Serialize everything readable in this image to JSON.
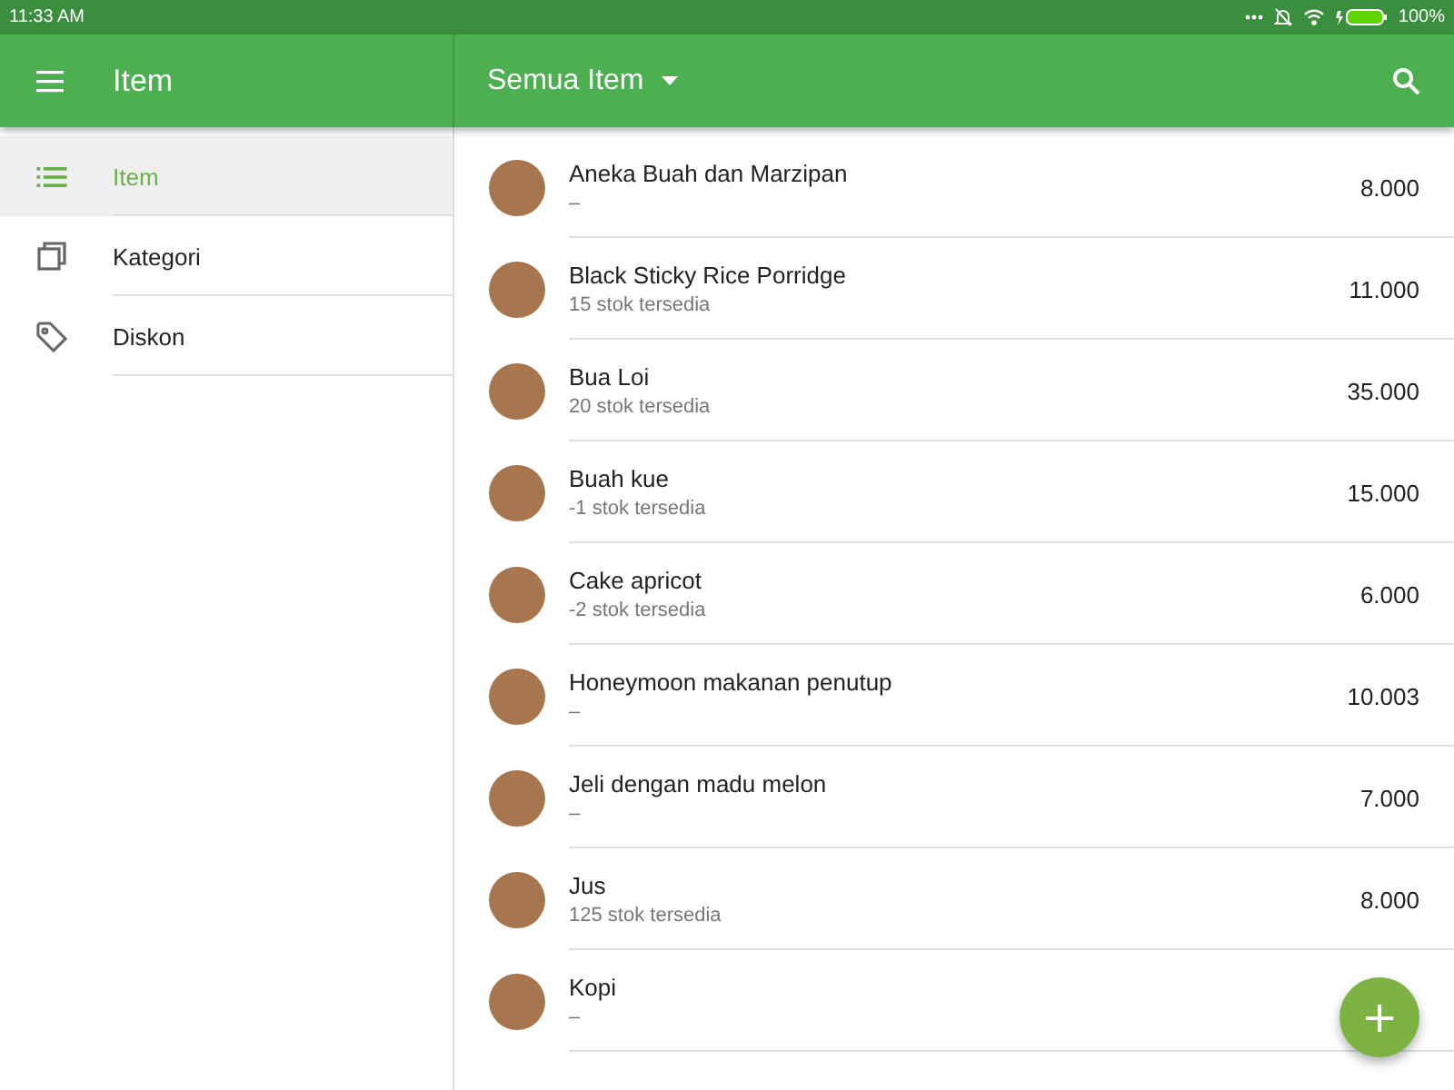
{
  "status_bar": {
    "time": "11:33 AM",
    "battery": "100%"
  },
  "app_bar": {
    "title": "Item",
    "filter": "Semua Item"
  },
  "sidebar": {
    "items": [
      {
        "label": "Item",
        "kind": "list",
        "selected": true
      },
      {
        "label": "Kategori",
        "kind": "copy",
        "selected": false
      },
      {
        "label": "Diskon",
        "kind": "tag",
        "selected": false
      }
    ]
  },
  "items": [
    {
      "name": "Aneka Buah dan Marzipan",
      "stock": "–",
      "price": "8.000"
    },
    {
      "name": "Black Sticky Rice Porridge",
      "stock": "15 stok tersedia",
      "price": "11.000"
    },
    {
      "name": "Bua Loi",
      "stock": "20 stok tersedia",
      "price": "35.000"
    },
    {
      "name": "Buah kue",
      "stock": "-1 stok tersedia",
      "price": "15.000"
    },
    {
      "name": "Cake apricot",
      "stock": "-2 stok tersedia",
      "price": "6.000"
    },
    {
      "name": "Honeymoon makanan penutup",
      "stock": "–",
      "price": "10.003"
    },
    {
      "name": "Jeli dengan madu melon",
      "stock": "–",
      "price": "7.000"
    },
    {
      "name": "Jus",
      "stock": "125 stok tersedia",
      "price": "8.000"
    },
    {
      "name": "Kopi",
      "stock": "–"
    }
  ],
  "fab": {
    "label": "+"
  }
}
